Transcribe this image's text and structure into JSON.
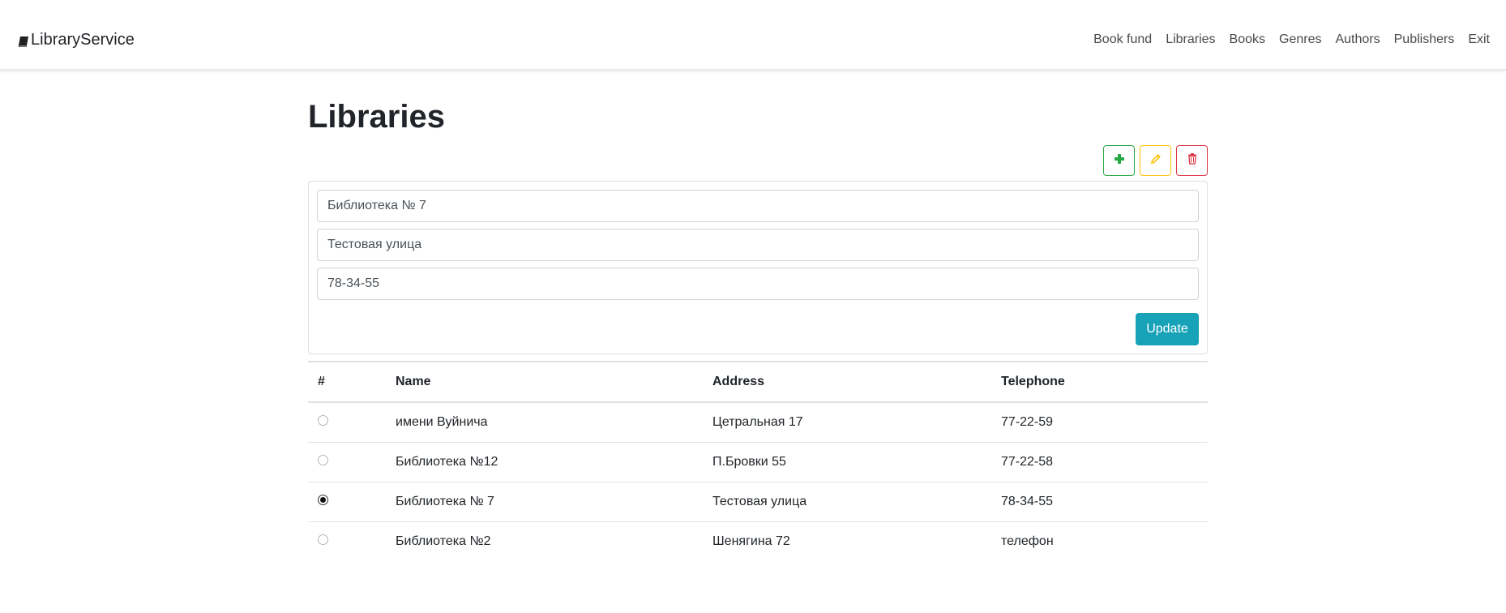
{
  "navbar": {
    "brand": "LibraryService",
    "links": [
      "Book fund",
      "Libraries",
      "Books",
      "Genres",
      "Authors",
      "Publishers",
      "Exit"
    ]
  },
  "page": {
    "title": "Libraries"
  },
  "form": {
    "name_value": "Библиотека № 7",
    "address_value": "Тестовая улица",
    "telephone_value": "78-34-55",
    "update_label": "Update"
  },
  "colors": {
    "add": "#28a745",
    "edit": "#ffc107",
    "delete": "#dc3545",
    "update": "#17a2b8"
  },
  "icons": {
    "brand": "book-icon",
    "add": "plus-icon",
    "edit": "pencil-icon",
    "delete": "trash-icon"
  },
  "table": {
    "headers": [
      "#",
      "Name",
      "Address",
      "Telephone"
    ],
    "rows": [
      {
        "selected": false,
        "name": "имени Вуйнича",
        "address": "Цетральная 17",
        "telephone": "77-22-59"
      },
      {
        "selected": false,
        "name": "Библиотека №12",
        "address": "П.Бровки 55",
        "telephone": "77-22-58"
      },
      {
        "selected": true,
        "name": "Библиотека № 7",
        "address": "Тестовая улица",
        "telephone": "78-34-55"
      },
      {
        "selected": false,
        "name": "Библиотека №2",
        "address": "Шенягина 72",
        "telephone": "телефон"
      }
    ]
  }
}
